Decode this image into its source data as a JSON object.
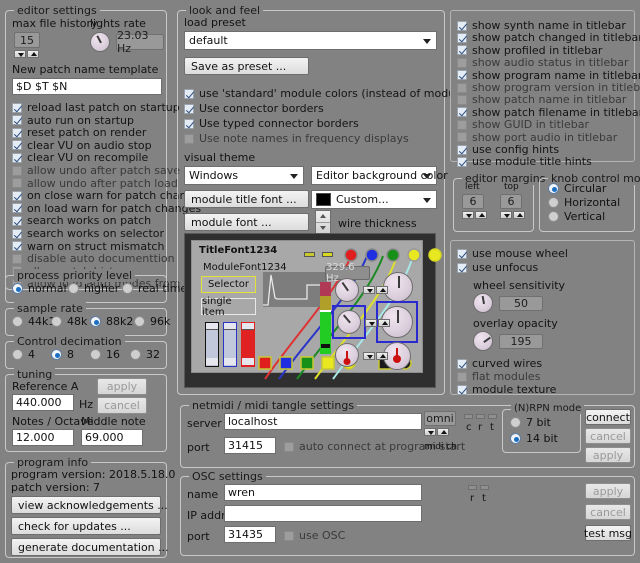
{
  "app": {
    "background": "#828282",
    "accent": "#1a6fc4"
  },
  "editor_settings": {
    "title": "editor settings",
    "max_file_history_label": "max file history",
    "max_file_history_value": "15",
    "lights_rate_label": "lights rate",
    "lights_rate_value": "23.03 Hz",
    "patch_template_label": "New patch name template",
    "patch_template_value": "$D $T $N",
    "checkboxes": [
      {
        "label": "reload last patch on startup",
        "checked": true
      },
      {
        "label": "auto run on startup",
        "checked": true
      },
      {
        "label": "reset patch on render",
        "checked": true
      },
      {
        "label": "clear VU on audio stop",
        "checked": true
      },
      {
        "label": "clear VU on recompile",
        "checked": true
      },
      {
        "label": "allow undo after patch save",
        "checked": false
      },
      {
        "label": "allow undo after patch load",
        "checked": false
      },
      {
        "label": "on close warn for patch changes",
        "checked": true
      },
      {
        "label": "on load warn for patch changes",
        "checked": true
      },
      {
        "label": "search works on patch",
        "checked": true
      },
      {
        "label": "search works on selector",
        "checked": true
      },
      {
        "label": "warn on struct mismatch",
        "checked": true
      },
      {
        "label": "disable auto documenttion",
        "checked": false
      },
      {
        "label": "allow patch history",
        "checked": false
      },
      {
        "label": "allow load auto modes from ini",
        "checked": false
      }
    ]
  },
  "process_priority": {
    "title": "process priority level",
    "options": [
      {
        "label": "normal",
        "selected": true
      },
      {
        "label": "higher",
        "selected": false
      },
      {
        "label": "real time",
        "selected": false
      }
    ]
  },
  "sample_rate": {
    "title": "sample rate",
    "options": [
      {
        "label": "44k1",
        "selected": false
      },
      {
        "label": "48k",
        "selected": false
      },
      {
        "label": "88k2",
        "selected": true
      },
      {
        "label": "96k",
        "selected": false
      }
    ]
  },
  "control_decimation": {
    "title": "Control decimation",
    "options": [
      {
        "label": "4",
        "selected": false
      },
      {
        "label": "8",
        "selected": true
      },
      {
        "label": "16",
        "selected": false
      },
      {
        "label": "32",
        "selected": false
      }
    ]
  },
  "tuning": {
    "title": "tuning",
    "reference_a_label": "Reference A",
    "reference_a_value": "440.000",
    "hz_label": "Hz",
    "apply_label": "apply",
    "cancel_label": "cancel",
    "notes_octave_label": "Notes / Octave",
    "notes_octave_value": "12.000",
    "middle_note_label": "Middle note",
    "middle_note_value": "69.000"
  },
  "program_info": {
    "title": "program info",
    "program_version": "program version: 2018.5.18.0",
    "patch_version": "patch version: 7",
    "buttons": [
      "view acknowledgements ...",
      "check for updates ...",
      "generate documentation ..."
    ]
  },
  "look_and_feel": {
    "title": "look and feel",
    "load_preset_label": "load preset",
    "preset_value": "default",
    "save_preset_label": "Save as preset ...",
    "checkboxes": [
      {
        "label": "use 'standard' module colors (instead of module color)",
        "checked": true
      },
      {
        "label": "Use connector borders",
        "checked": true
      },
      {
        "label": "Use typed connector borders",
        "checked": true
      },
      {
        "label": "Use note names in frequency displays",
        "checked": false
      }
    ],
    "visual_theme_label": "visual theme",
    "theme_value": "Windows",
    "bg_color_target_value": "Editor background color",
    "module_title_font_label": "module title font ...",
    "module_font_label": "module font ...",
    "custom_color_value": "Custom...",
    "custom_color_swatch": "#000000",
    "wire_thickness_label": "wire thickness"
  },
  "preview": {
    "title_font_sample": "TitleFont1234",
    "module_font_sample": "ModuleFont1234",
    "selector_label": "Selector",
    "single_item_label": "single item",
    "frequency_readout": "329.6 Hz"
  },
  "titlebar_options": {
    "checkboxes": [
      {
        "label": "show synth name in titlebar",
        "checked": true
      },
      {
        "label": "show patch changed in titlebar",
        "checked": true
      },
      {
        "label": "show profiled in titlebar",
        "checked": true
      },
      {
        "label": "show audio status in titlebar",
        "checked": false
      },
      {
        "label": "show program name in titlebar",
        "checked": true
      },
      {
        "label": "show program version in titlebar",
        "checked": false
      },
      {
        "label": "show patch name in titlebar",
        "checked": false
      },
      {
        "label": "show patch filename in titlebar",
        "checked": true
      },
      {
        "label": "show GUID in titlebar",
        "checked": false
      },
      {
        "label": "show port audio in titlebar",
        "checked": false
      },
      {
        "label": "use config hints",
        "checked": true
      },
      {
        "label": "use module title hints",
        "checked": true
      }
    ]
  },
  "editor_margins": {
    "title": "editor margins",
    "left_label": "left",
    "left_value": "6",
    "top_label": "top",
    "top_value": "6"
  },
  "knob_control_mode": {
    "title": "knob control mode",
    "options": [
      {
        "label": "Circular",
        "selected": true
      },
      {
        "label": "Horizontal",
        "selected": false
      },
      {
        "label": "Vertical",
        "selected": false
      }
    ]
  },
  "mouse_options": {
    "checkboxes_top": [
      {
        "label": "use mouse wheel",
        "checked": true
      },
      {
        "label": "use unfocus",
        "checked": true
      }
    ],
    "wheel_sensitivity_label": "wheel sensitivity",
    "wheel_sensitivity_value": "50",
    "overlay_opacity_label": "overlay opacity",
    "overlay_opacity_value": "195",
    "checkboxes_bottom": [
      {
        "label": "curved wires",
        "checked": true
      },
      {
        "label": "flat modules",
        "checked": false
      },
      {
        "label": "module texture",
        "checked": true
      }
    ]
  },
  "netmidi": {
    "title": "netmidi / midi tangle settings",
    "server_label": "server",
    "server_value": "localhost",
    "port_label": "port",
    "port_value": "31415",
    "auto_connect_label": "auto connect at program start",
    "auto_connect_checked": false,
    "omni_label": "omni",
    "midi_ch_label": "midi ch",
    "indicators": [
      "c",
      "r",
      "t"
    ],
    "rpn_title": "(N)RPN mode",
    "rpn_options": [
      {
        "label": "7 bit",
        "selected": false
      },
      {
        "label": "14 bit",
        "selected": true
      }
    ],
    "connect_label": "connect",
    "cancel_label": "cancel",
    "apply_label": "apply"
  },
  "osc": {
    "title": "OSC settings",
    "name_label": "name",
    "name_value": "wren",
    "ip_label": "IP addr",
    "ip_value": "",
    "port_label": "port",
    "port_value": "31435",
    "use_osc_label": "use OSC",
    "use_osc_checked": false,
    "indicators": [
      "r",
      "t"
    ],
    "apply_label": "apply",
    "cancel_label": "cancel",
    "test_msg_label": "test msg"
  }
}
